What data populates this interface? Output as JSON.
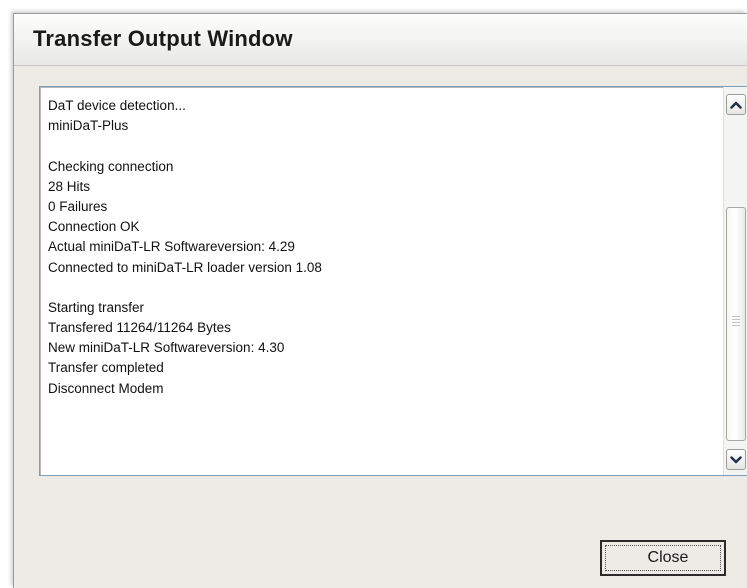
{
  "window": {
    "title": "Transfer Output Window"
  },
  "output": {
    "lines": [
      "DaT device detection...",
      "miniDaT-Plus",
      "",
      "Checking connection",
      "28 Hits",
      "0 Failures",
      "Connection OK",
      "Actual miniDaT-LR Softwareversion: 4.29",
      "Connected to miniDaT-LR loader version 1.08",
      "",
      "Starting transfer",
      "Transfered 11264/11264 Bytes",
      "New miniDaT-LR Softwareversion: 4.30",
      "Transfer completed",
      "Disconnect Modem"
    ]
  },
  "scrollbar": {
    "up_icon": "chevron-up-icon",
    "down_icon": "chevron-down-icon"
  },
  "buttons": {
    "close_label": "Close"
  },
  "colors": {
    "window_bg": "#ecebe6",
    "output_border": "#7f9db9",
    "text": "#111111"
  }
}
